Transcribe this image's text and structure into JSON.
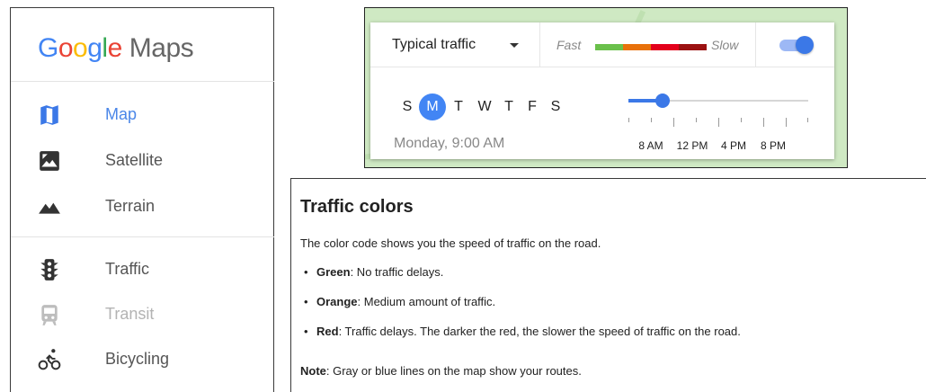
{
  "sidebar": {
    "logo": {
      "google": "Google",
      "maps": "Maps",
      "letter_colors": [
        "#4285f4",
        "#ea4335",
        "#fbbc05",
        "#4285f4",
        "#34a853",
        "#ea4335"
      ]
    },
    "base_layers": [
      {
        "label": "Map",
        "icon": "map-icon",
        "active": true
      },
      {
        "label": "Satellite",
        "icon": "satellite-icon",
        "active": false
      },
      {
        "label": "Terrain",
        "icon": "terrain-icon",
        "active": false
      }
    ],
    "overlay_layers": [
      {
        "label": "Traffic",
        "icon": "traffic-light-icon",
        "disabled": false
      },
      {
        "label": "Transit",
        "icon": "transit-icon",
        "disabled": true
      },
      {
        "label": "Bicycling",
        "icon": "bicycle-icon",
        "disabled": false
      }
    ]
  },
  "traffic_widget": {
    "mode_label": "Typical traffic",
    "legend": {
      "fast_label": "Fast",
      "slow_label": "Slow",
      "colors": [
        "#6ac04b",
        "#e8710a",
        "#e3001b",
        "#9b1111"
      ]
    },
    "toggle_on": true,
    "days": [
      "S",
      "M",
      "T",
      "W",
      "T",
      "F",
      "S"
    ],
    "selected_day_index": 1,
    "selected_time": "Monday, 9:00 AM",
    "time_labels": [
      "8 AM",
      "12 PM",
      "4 PM",
      "8 PM"
    ],
    "time_position_fraction": 0.19,
    "accent_color": "#4285f4"
  },
  "help": {
    "title": "Traffic colors",
    "intro": "The color code shows you the speed of traffic on the road.",
    "items": [
      {
        "term": "Green",
        "text": ": No traffic delays."
      },
      {
        "term": "Orange",
        "text": ": Medium amount of traffic."
      },
      {
        "term": "Red",
        "text": ": Traffic delays. The darker the red, the slower the speed of traffic on the road."
      }
    ],
    "note_term": "Note",
    "note_text": ": Gray or blue lines on the map show your routes."
  }
}
